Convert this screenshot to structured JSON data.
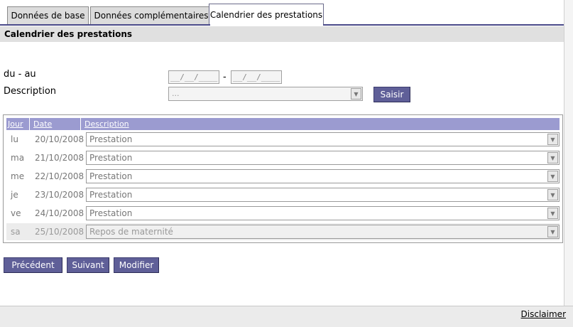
{
  "tabs": [
    {
      "label": "Données de base"
    },
    {
      "label": "Données complémentaires"
    },
    {
      "label": "Calendrier des prestations"
    }
  ],
  "section": {
    "title": "Calendrier des prestations"
  },
  "form": {
    "range_label": "du - au",
    "from_date": "__/__/____",
    "range_sep": "-",
    "to_date": "__/__/____",
    "description_label": "Description",
    "description_value": "...",
    "submit_label": "Saisir"
  },
  "table": {
    "headers": [
      "Jour",
      "Date",
      "Description"
    ],
    "rows": [
      {
        "day": "lu",
        "date": "20/10/2008",
        "desc": "Prestation"
      },
      {
        "day": "ma",
        "date": "21/10/2008",
        "desc": "Prestation"
      },
      {
        "day": "me",
        "date": "22/10/2008",
        "desc": "Prestation"
      },
      {
        "day": "je",
        "date": "23/10/2008",
        "desc": "Prestation"
      },
      {
        "day": "ve",
        "date": "24/10/2008",
        "desc": "Prestation"
      },
      {
        "day": "sa",
        "date": "25/10/2008",
        "desc": "Repos de maternité"
      }
    ]
  },
  "buttons": {
    "previous": "Précédent",
    "next": "Suivant",
    "modify": "Modifier"
  },
  "footer": {
    "disclaimer": "Disclaimer"
  },
  "colors": {
    "accent": "#5f5f98",
    "header": "#9b9bd0"
  }
}
